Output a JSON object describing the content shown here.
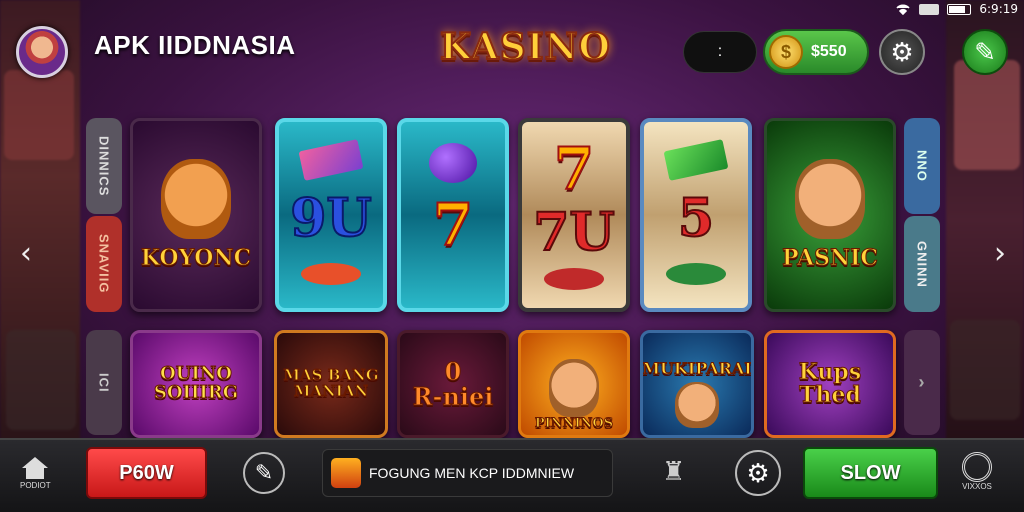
{
  "status": {
    "time": "6:9:19"
  },
  "header": {
    "app_title": "APK IIDDNASIA",
    "logo_text": "KASINO",
    "dark_pill_label": ":",
    "coin_balance": "$550",
    "coin_symbol": "$"
  },
  "side_tabs": {
    "left": [
      "DINNICS",
      "SNAVIIG",
      "ICI"
    ],
    "right": [
      "NNO",
      "GNINN",
      "›"
    ]
  },
  "row1": [
    {
      "title": "KOYONC"
    },
    {
      "symbols": [
        "",
        "9U",
        ""
      ]
    },
    {
      "symbols": [
        "",
        "7",
        ""
      ]
    },
    {
      "symbols": [
        "7",
        "7U",
        ""
      ]
    },
    {
      "symbols": [
        "",
        "5",
        ""
      ]
    },
    {
      "title": "PASNIC"
    }
  ],
  "row2": [
    {
      "title": "OUINO\nSOIIIRG"
    },
    {
      "title": "MAS BANG\nMANIAN"
    },
    {
      "title": "0\nR-niei"
    },
    {
      "title": "PINNINOS"
    },
    {
      "title": "MUKIPARAI"
    },
    {
      "title": "Kups\nThed"
    }
  ],
  "bottom": {
    "home_label": "PODIOT",
    "red_button": "P60W",
    "ticker_text": "FOGUNG MEN KCP IDDMNIEW",
    "green_button": "SLOW",
    "right_label": "VIXXOS"
  },
  "colors": {
    "accent_green": "#2a8a2a",
    "accent_red": "#c81818",
    "gold": "#ffcf3a"
  }
}
